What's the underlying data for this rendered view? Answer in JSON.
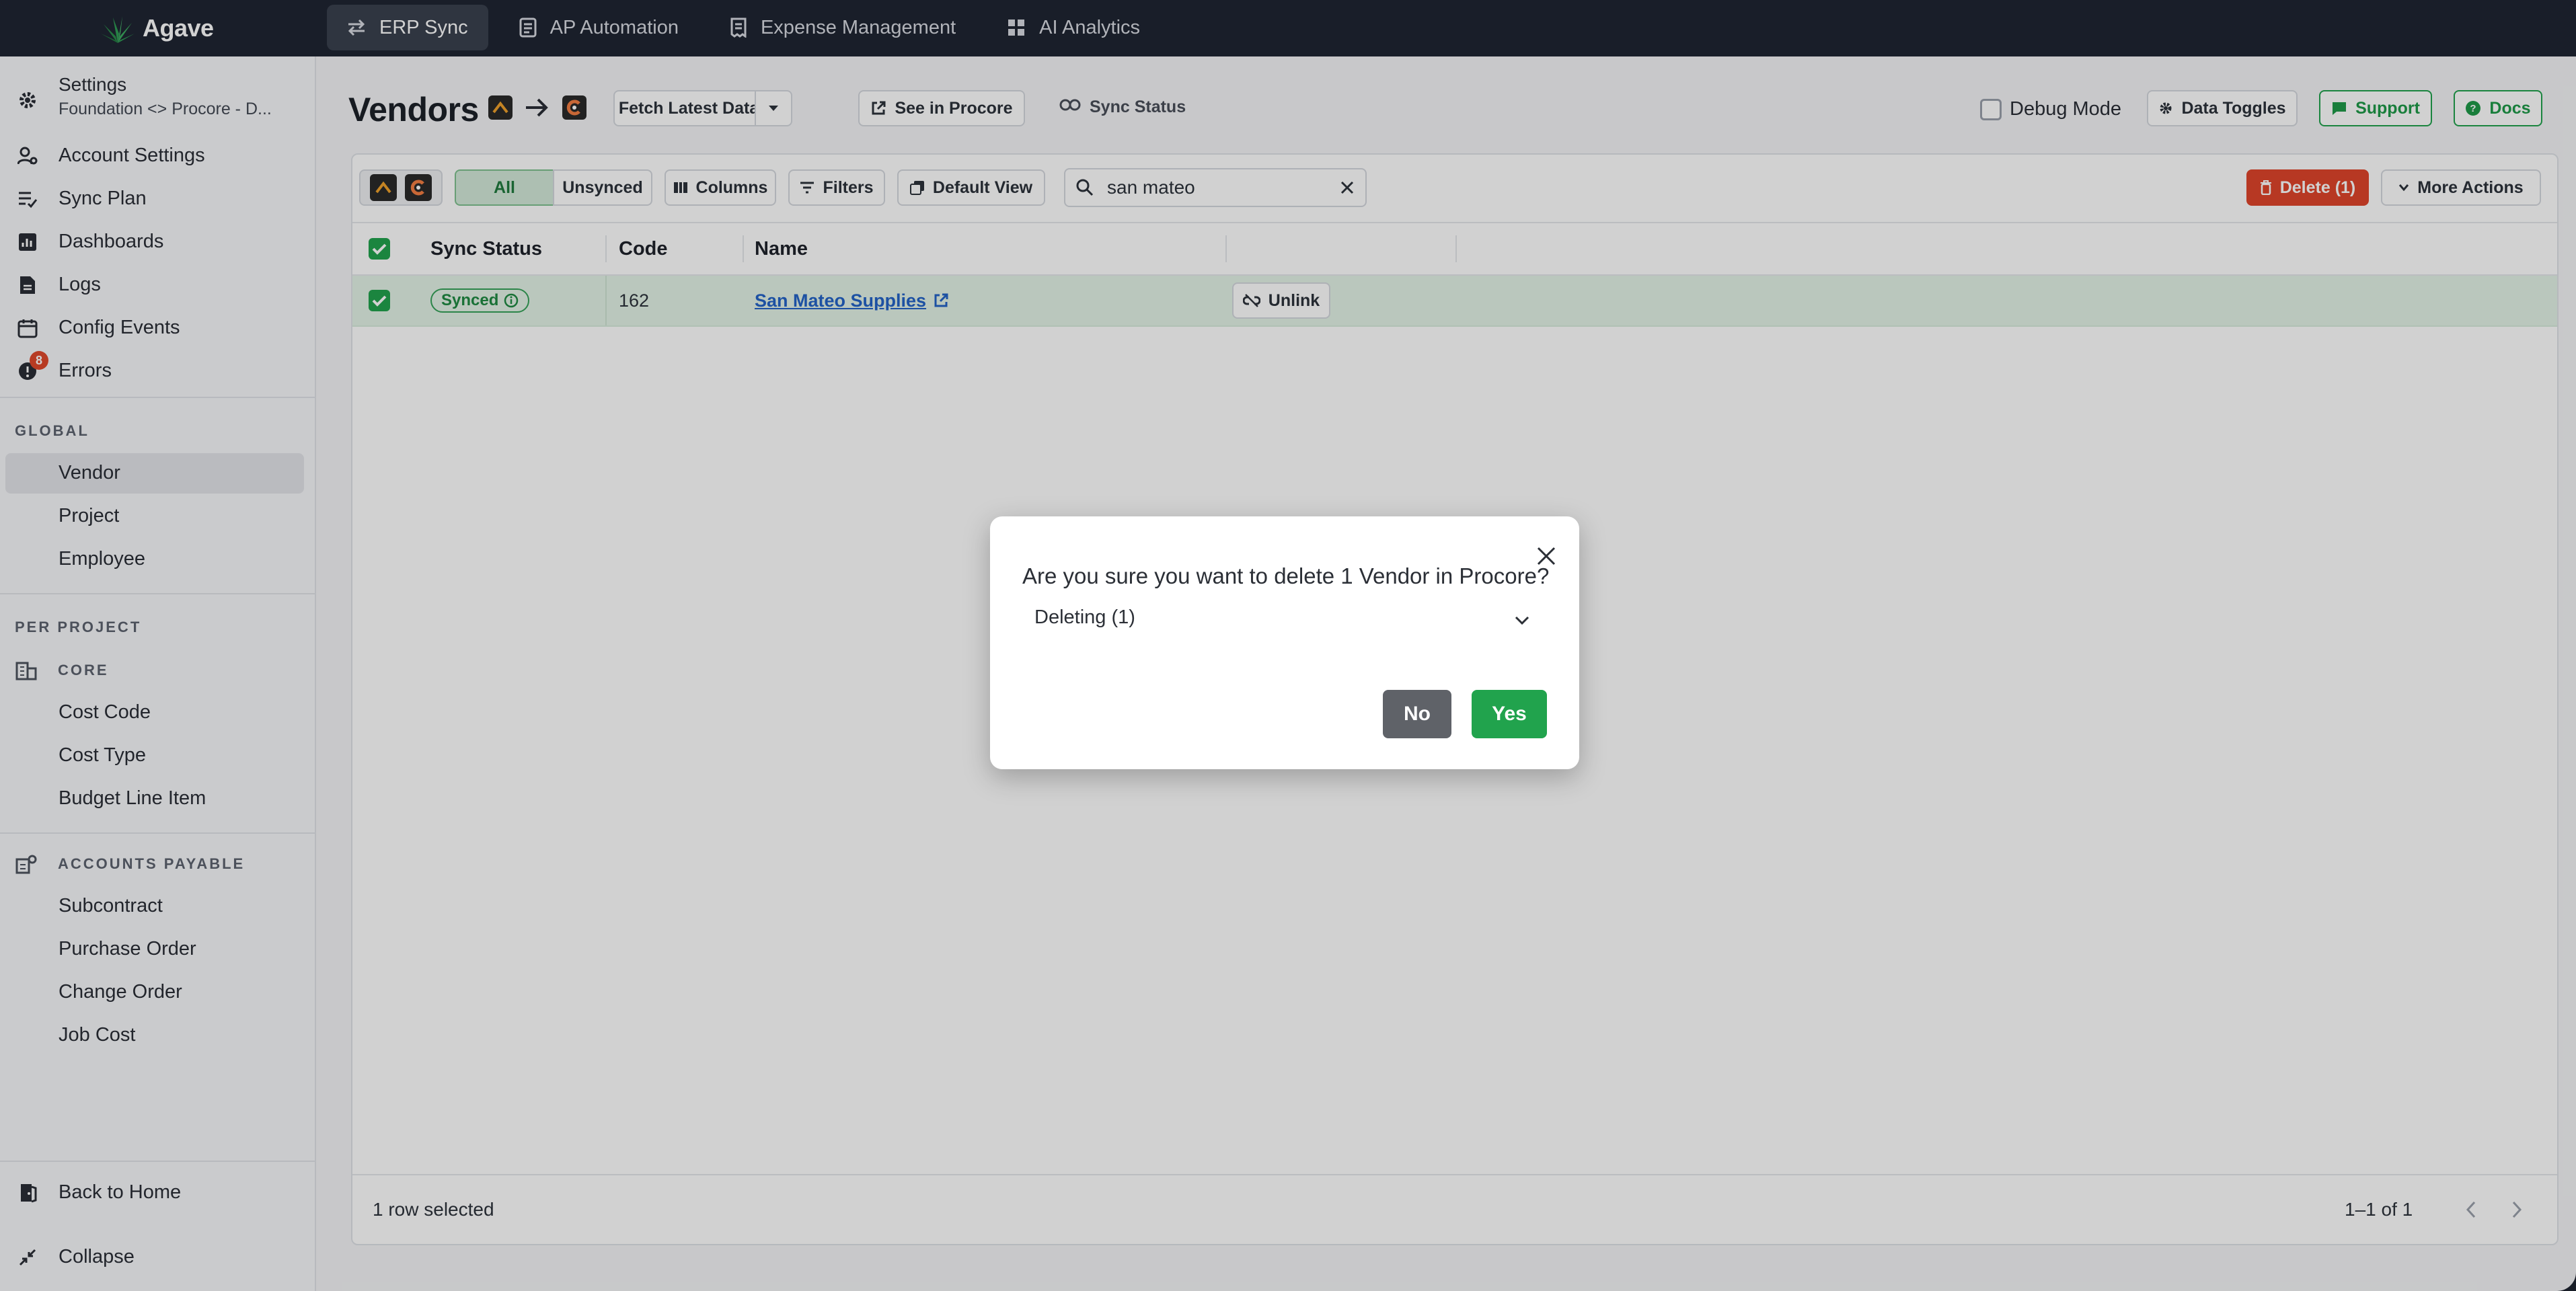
{
  "app": {
    "name": "Agave"
  },
  "nav": {
    "tabs": [
      {
        "label": "ERP Sync",
        "active": true
      },
      {
        "label": "AP Automation"
      },
      {
        "label": "Expense Management"
      },
      {
        "label": "AI Analytics"
      }
    ]
  },
  "sidebar": {
    "settings": {
      "title": "Settings",
      "subtitle": "Foundation <> Procore - D..."
    },
    "items": [
      {
        "label": "Account Settings",
        "icon": "user-gear-icon"
      },
      {
        "label": "Sync Plan",
        "icon": "list-check-icon"
      },
      {
        "label": "Dashboards",
        "icon": "chart-icon"
      },
      {
        "label": "Logs",
        "icon": "document-icon"
      },
      {
        "label": "Config Events",
        "icon": "calendar-icon"
      },
      {
        "label": "Errors",
        "icon": "error-icon",
        "badge": "8"
      }
    ],
    "global_label": "GLOBAL",
    "global_items": [
      "Vendor",
      "Project",
      "Employee"
    ],
    "per_project_label": "PER PROJECT",
    "core_label": "CORE",
    "core_items": [
      "Cost Code",
      "Cost Type",
      "Budget Line Item"
    ],
    "ap_label": "ACCOUNTS PAYABLE",
    "ap_items": [
      "Subcontract",
      "Purchase Order",
      "Change Order",
      "Job Cost"
    ],
    "back_home": "Back to Home",
    "collapse": "Collapse"
  },
  "header": {
    "title": "Vendors",
    "fetch_label": "Fetch Latest Data",
    "see_in_label": "See in Procore",
    "sync_status_label": "Sync Status",
    "debug_label": "Debug Mode",
    "data_toggles_label": "Data Toggles",
    "support_label": "Support",
    "docs_label": "Docs"
  },
  "toolbar": {
    "seg_all": "All",
    "seg_unsynced": "Unsynced",
    "columns_label": "Columns",
    "filters_label": "Filters",
    "default_view_label": "Default View",
    "search_value": "san mateo",
    "delete_label": "Delete (1)",
    "more_actions_label": "More Actions"
  },
  "table": {
    "columns": [
      "Sync Status",
      "Code",
      "Name"
    ],
    "rows": [
      {
        "status": "Synced",
        "code": "162",
        "name": "San Mateo Supplies",
        "action": "Unlink",
        "selected": true
      }
    ],
    "footer_selected": "1 row selected",
    "pagination": "1–1 of 1"
  },
  "modal": {
    "title": "Are you sure you want to delete 1 Vendor in Procore?",
    "select_label": "Deleting (1)",
    "no_label": "No",
    "yes_label": "Yes"
  },
  "colors": {
    "brand_green": "#21a34d",
    "danger": "#e0452b",
    "topbar": "#1f2532",
    "no_button": "#5f6268"
  }
}
